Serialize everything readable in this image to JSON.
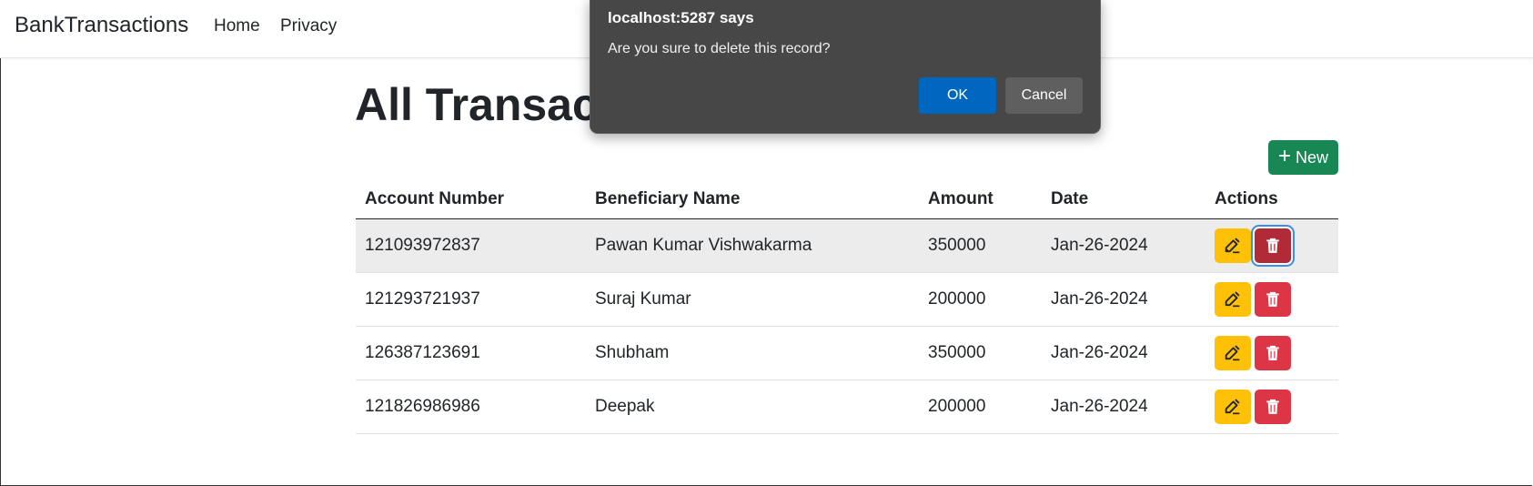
{
  "navbar": {
    "brand": "BankTransactions",
    "links": [
      "Home",
      "Privacy"
    ]
  },
  "page": {
    "title": "All Transactions",
    "new_button_label": "New"
  },
  "table": {
    "headers": [
      "Account Number",
      "Beneficiary Name",
      "Amount",
      "Date",
      "Actions"
    ],
    "rows": [
      {
        "account": "121093972837",
        "beneficiary": "Pawan Kumar Vishwakarma",
        "amount": "350000",
        "date": "Jan-26-2024"
      },
      {
        "account": "121293721937",
        "beneficiary": "Suraj Kumar",
        "amount": "200000",
        "date": "Jan-26-2024"
      },
      {
        "account": "126387123691",
        "beneficiary": "Shubham",
        "amount": "350000",
        "date": "Jan-26-2024"
      },
      {
        "account": "121826986986",
        "beneficiary": "Deepak",
        "amount": "200000",
        "date": "Jan-26-2024"
      }
    ],
    "row_icons": {
      "edit": "edit-icon",
      "delete": "trash-icon"
    }
  },
  "dialog": {
    "title": "localhost:5287 says",
    "message": "Are you sure to delete this record?",
    "ok_label": "OK",
    "cancel_label": "Cancel"
  },
  "colors": {
    "success": "#198754",
    "warning": "#ffc107",
    "danger": "#dc3545",
    "dialog_bg": "#474747",
    "dialog_ok": "#0067c0"
  }
}
